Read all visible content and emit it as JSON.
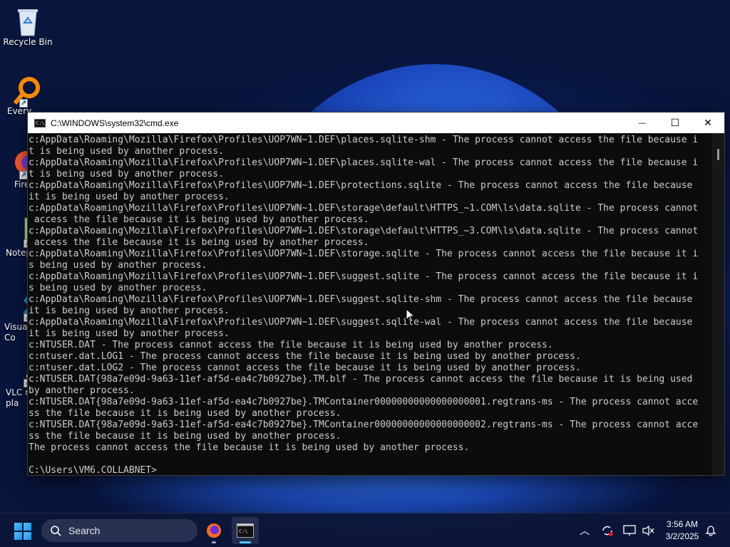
{
  "desktop": {
    "icons": [
      {
        "label": "Recycle Bin",
        "icon": "recycle-bin-icon"
      },
      {
        "label": "Every",
        "icon": "everything-search-icon"
      },
      {
        "label": "Fire",
        "icon": "firefox-icon"
      },
      {
        "label": "Notep",
        "icon": "notepad-icon"
      },
      {
        "label": "Visual\nCo",
        "icon": "vscode-icon"
      },
      {
        "label": "VLC r\npla",
        "icon": "vlc-icon"
      }
    ]
  },
  "window": {
    "title": "C:\\WINDOWS\\system32\\cmd.exe",
    "minimize_glyph": "—",
    "maximize_glyph": "☐",
    "close_glyph": "✕",
    "console_lines": [
      "c:AppData\\Roaming\\Mozilla\\Firefox\\Profiles\\UOP7WN~1.DEF\\places.sqlite-shm - The process cannot access the file because i",
      "t is being used by another process.",
      "c:AppData\\Roaming\\Mozilla\\Firefox\\Profiles\\UOP7WN~1.DEF\\places.sqlite-wal - The process cannot access the file because i",
      "t is being used by another process.",
      "c:AppData\\Roaming\\Mozilla\\Firefox\\Profiles\\UOP7WN~1.DEF\\protections.sqlite - The process cannot access the file because",
      "it is being used by another process.",
      "c:AppData\\Roaming\\Mozilla\\Firefox\\Profiles\\UOP7WN~1.DEF\\storage\\default\\HTTPS_~1.COM\\ls\\data.sqlite - The process cannot",
      " access the file because it is being used by another process.",
      "c:AppData\\Roaming\\Mozilla\\Firefox\\Profiles\\UOP7WN~1.DEF\\storage\\default\\HTTPS_~3.COM\\ls\\data.sqlite - The process cannot",
      " access the file because it is being used by another process.",
      "c:AppData\\Roaming\\Mozilla\\Firefox\\Profiles\\UOP7WN~1.DEF\\storage.sqlite - The process cannot access the file because it i",
      "s being used by another process.",
      "c:AppData\\Roaming\\Mozilla\\Firefox\\Profiles\\UOP7WN~1.DEF\\suggest.sqlite - The process cannot access the file because it i",
      "s being used by another process.",
      "c:AppData\\Roaming\\Mozilla\\Firefox\\Profiles\\UOP7WN~1.DEF\\suggest.sqlite-shm - The process cannot access the file because",
      "it is being used by another process.",
      "c:AppData\\Roaming\\Mozilla\\Firefox\\Profiles\\UOP7WN~1.DEF\\suggest.sqlite-wal - The process cannot access the file because",
      "it is being used by another process.",
      "c:NTUSER.DAT - The process cannot access the file because it is being used by another process.",
      "c:ntuser.dat.LOG1 - The process cannot access the file because it is being used by another process.",
      "c:ntuser.dat.LOG2 - The process cannot access the file because it is being used by another process.",
      "c:NTUSER.DAT{98a7e09d-9a63-11ef-af5d-ea4c7b0927be}.TM.blf - The process cannot access the file because it is being used",
      "by another process.",
      "c:NTUSER.DAT{98a7e09d-9a63-11ef-af5d-ea4c7b0927be}.TMContainer00000000000000000001.regtrans-ms - The process cannot acce",
      "ss the file because it is being used by another process.",
      "c:NTUSER.DAT{98a7e09d-9a63-11ef-af5d-ea4c7b0927be}.TMContainer00000000000000000002.regtrans-ms - The process cannot acce",
      "ss the file because it is being used by another process.",
      "The process cannot access the file because it is being used by another process.",
      "",
      "C:\\Users\\VM6.COLLABNET>"
    ]
  },
  "taskbar": {
    "search_label": "Search",
    "apps": [
      {
        "name": "Firefox",
        "icon": "firefox-icon",
        "active": false
      },
      {
        "name": "Command Prompt",
        "icon": "terminal-icon",
        "active": true
      }
    ],
    "tray": {
      "chevron_glyph": "︿",
      "time": "3:56 AM",
      "date": "3/2/2025"
    }
  },
  "colors": {
    "console_bg": "#0c0c0c",
    "console_fg": "#cccccc",
    "accent": "#4fc3ff"
  }
}
